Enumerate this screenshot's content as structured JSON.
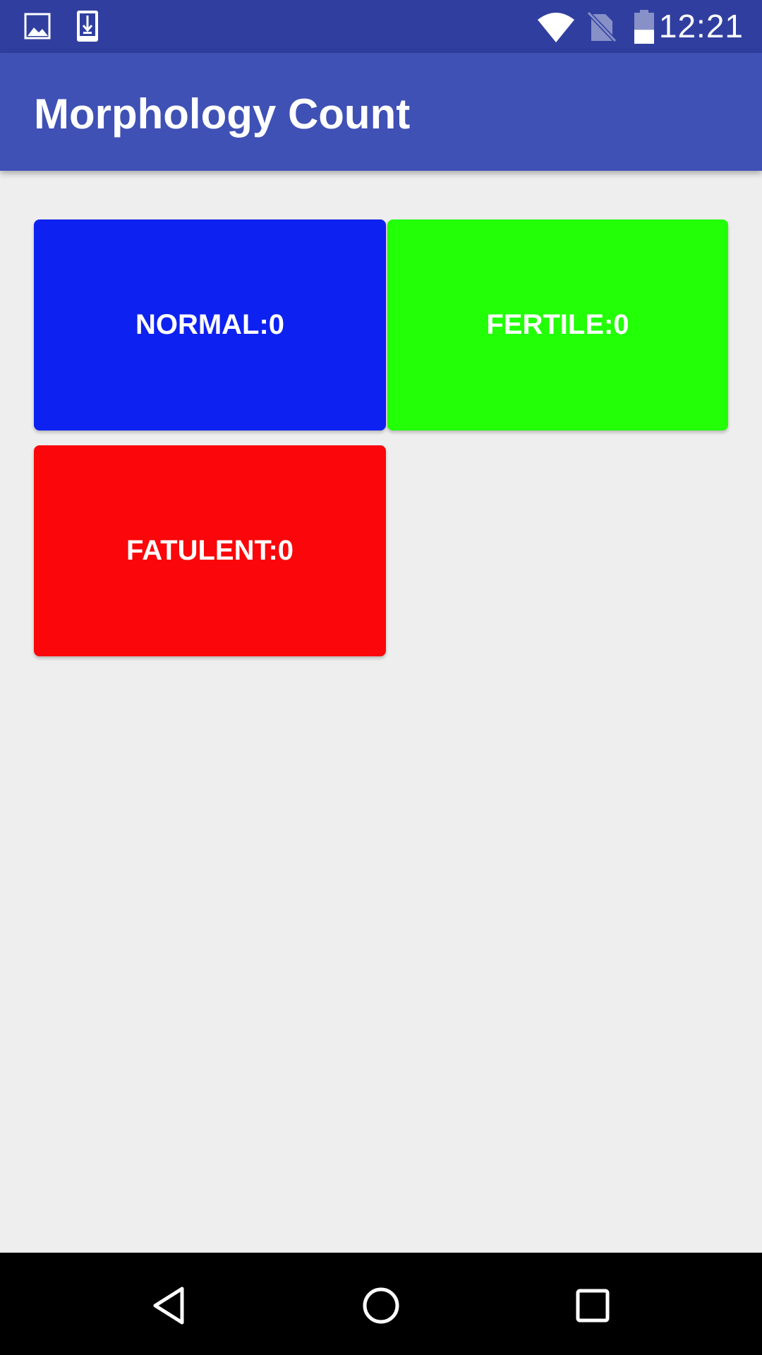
{
  "status_bar": {
    "time": "12:21",
    "left_icons": [
      "image-icon",
      "download-icon"
    ],
    "right_icons": [
      "wifi-icon",
      "no-sim-icon",
      "battery-icon"
    ],
    "battery_level": 0.45
  },
  "app_bar": {
    "title": "Morphology Count"
  },
  "buttons": {
    "normal": {
      "label": "NORMAL:0",
      "color": "#0d21f0"
    },
    "fertile": {
      "label": "FERTILE:0",
      "color": "#22ff07"
    },
    "fatulent": {
      "label": "FATULENT:0",
      "color": "#fb060a"
    }
  },
  "nav_bar": {
    "icons": [
      "back-icon",
      "home-icon",
      "recents-icon"
    ]
  },
  "colors": {
    "status_bar": "#303f9f",
    "app_bar": "#3f51b5",
    "background": "#eeeeee"
  }
}
